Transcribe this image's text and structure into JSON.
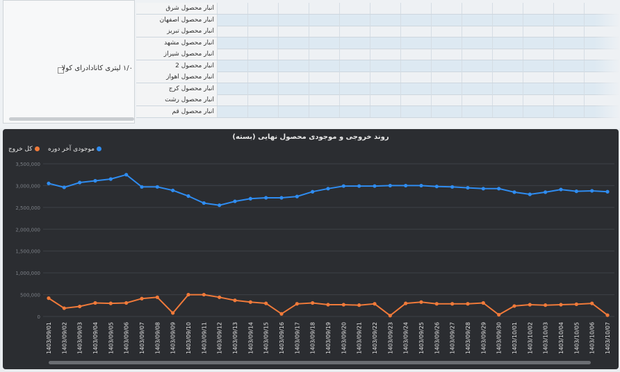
{
  "top_table": {
    "tree_label": "۱/۰ لیتری کانادادرای کولا",
    "rows": [
      "انبار محصول شرق",
      "انبار محصول اصفهان",
      "انبار محصول تبریز",
      "انبار محصول مشهد",
      "انبار محصول شیراز",
      "انبار محصول 2",
      "انبار محصول اهواز",
      "انبار محصول کرج",
      "انبار محصول رشت",
      "انبار محصول قم"
    ]
  },
  "chart": {
    "title": "روند خروجی و موجودی محصول نهایی (بسته)",
    "legend": [
      {
        "label": "موجودی آخر دوره",
        "color": "#2f8cf0"
      },
      {
        "label": "کل خروج",
        "color": "#f07a3a"
      }
    ],
    "colors": {
      "inventory": "#2f8cf0",
      "exit": "#f07a3a",
      "background": "#2b2d31"
    }
  },
  "chart_data": {
    "type": "line",
    "title": "روند خروجی و موجودی محصول نهایی (بسته)",
    "x": [
      "1403/09/01",
      "1403/09/02",
      "1403/09/03",
      "1403/09/04",
      "1403/09/05",
      "1403/09/06",
      "1403/09/07",
      "1403/09/08",
      "1403/09/09",
      "1403/09/10",
      "1403/09/11",
      "1403/09/12",
      "1403/09/13",
      "1403/09/14",
      "1403/09/15",
      "1403/09/16",
      "1403/09/17",
      "1403/09/18",
      "1403/09/19",
      "1403/09/20",
      "1403/09/21",
      "1403/09/22",
      "1403/09/23",
      "1403/09/24",
      "1403/09/25",
      "1403/09/26",
      "1403/09/27",
      "1403/09/28",
      "1403/09/29",
      "1403/09/30",
      "1403/10/01",
      "1403/10/02",
      "1403/10/03",
      "1403/10/04",
      "1403/10/05",
      "1403/10/06",
      "1403/10/07"
    ],
    "yticks": [
      "3,500,000",
      "3,000,000",
      "2,500,000",
      "2,000,000",
      "1,500,000",
      "1,000,000",
      "500,000",
      "0"
    ],
    "ylim": [
      0,
      3500000
    ],
    "series": [
      {
        "name": "موجودی آخر دوره",
        "values": [
          3050000,
          2960000,
          3070000,
          3110000,
          3150000,
          3250000,
          2970000,
          2970000,
          2890000,
          2760000,
          2600000,
          2550000,
          2640000,
          2700000,
          2720000,
          2720000,
          2750000,
          2860000,
          2930000,
          2990000,
          2990000,
          2990000,
          3000000,
          3000000,
          3000000,
          2980000,
          2970000,
          2950000,
          2930000,
          2930000,
          2850000,
          2800000,
          2850000,
          2910000,
          2870000,
          2880000,
          2860000
        ]
      },
      {
        "name": "کل خروج",
        "values": [
          420000,
          190000,
          230000,
          310000,
          300000,
          310000,
          410000,
          440000,
          80000,
          500000,
          500000,
          440000,
          370000,
          330000,
          300000,
          60000,
          290000,
          310000,
          270000,
          270000,
          260000,
          290000,
          20000,
          300000,
          330000,
          290000,
          290000,
          290000,
          310000,
          40000,
          240000,
          270000,
          260000,
          270000,
          280000,
          300000,
          30000
        ]
      }
    ],
    "grid": true,
    "legend_position": "top-right"
  }
}
